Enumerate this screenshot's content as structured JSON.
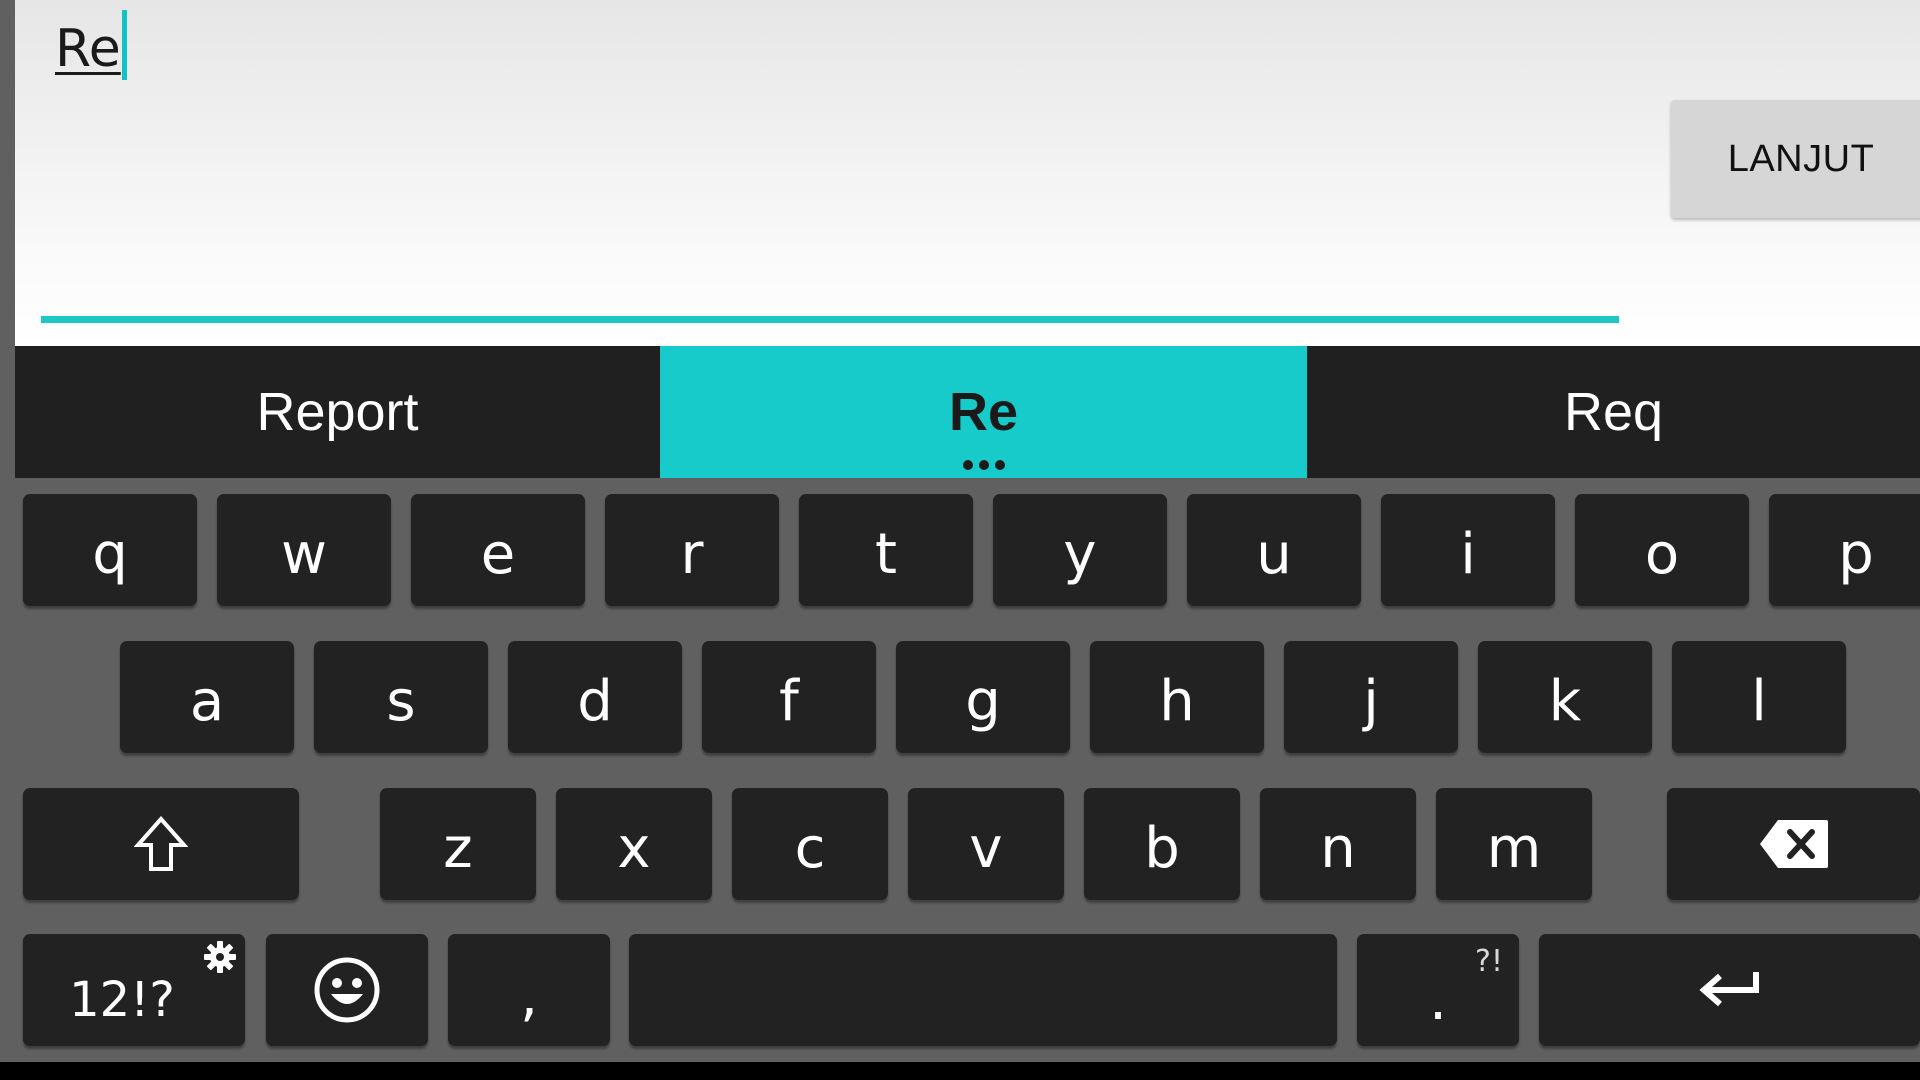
{
  "input": {
    "typed_text": "Re",
    "next_label": "LANJUT"
  },
  "suggestions": {
    "left": "Report",
    "middle": "Re",
    "right": "Req"
  },
  "keyboard": {
    "row1": [
      "q",
      "w",
      "e",
      "r",
      "t",
      "y",
      "u",
      "i",
      "o",
      "p"
    ],
    "row2": [
      "a",
      "s",
      "d",
      "f",
      "g",
      "h",
      "j",
      "k",
      "l"
    ],
    "row3": [
      "z",
      "x",
      "c",
      "v",
      "b",
      "n",
      "m"
    ],
    "symbols_label": "12!?",
    "comma_label": ",",
    "period_label": ".",
    "period_hint": "?!",
    "icons": {
      "shift": "shift-arrow-up-icon",
      "backspace": "backspace-x-icon",
      "settings": "gear-icon",
      "emoji": "smiley-icon",
      "enter": "enter-arrow-icon"
    }
  },
  "colors": {
    "accent": "#16cbca",
    "key_bg": "#222222",
    "keyboard_bg": "#606060",
    "suggestion_bar_bg": "#202020"
  }
}
